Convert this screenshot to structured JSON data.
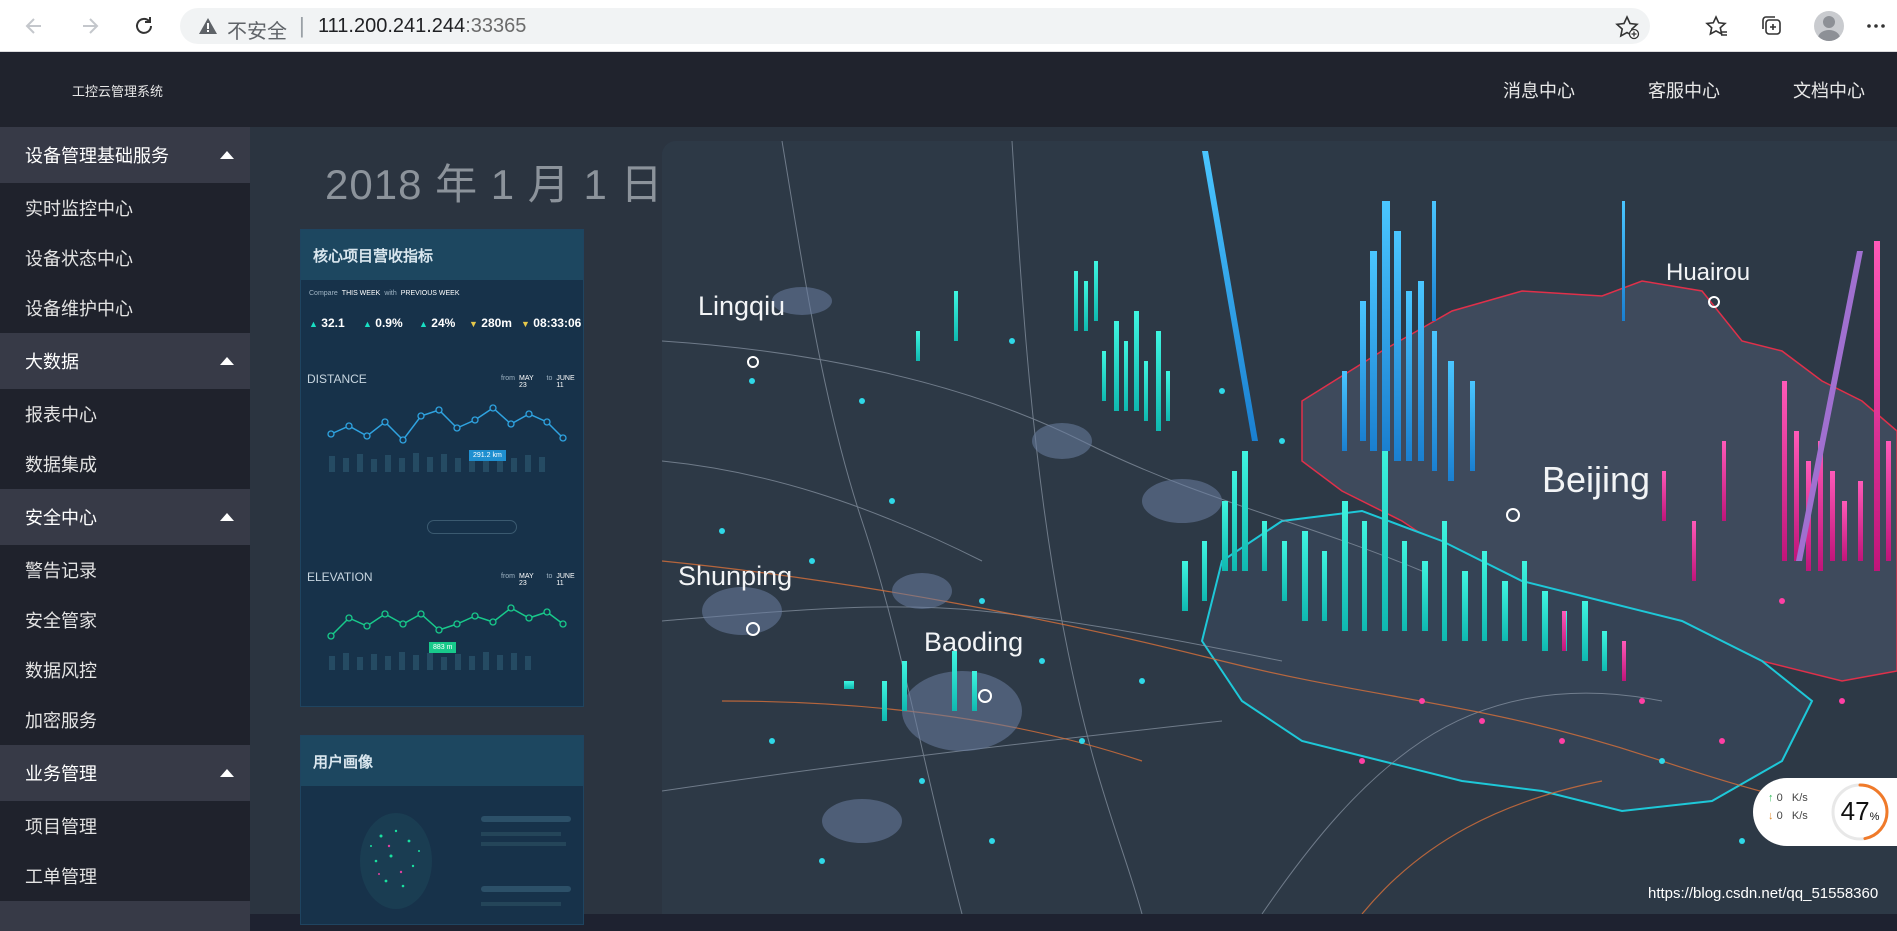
{
  "browser": {
    "insecure_label": "不安全",
    "separator": "|",
    "url_host": "111.200.241.244",
    "url_port": ":33365"
  },
  "header": {
    "app_title": "工控云管理系统",
    "nav": [
      "消息中心",
      "客服中心",
      "文档中心"
    ]
  },
  "sidebar": {
    "groups": [
      {
        "title": "设备管理基础服务",
        "items": [
          "实时监控中心",
          "设备状态中心",
          "设备维护中心"
        ]
      },
      {
        "title": "大数据",
        "items": [
          "报表中心",
          "数据集成"
        ]
      },
      {
        "title": "安全中心",
        "items": [
          "警告记录",
          "安全管家",
          "数据风控",
          "加密服务"
        ]
      },
      {
        "title": "业务管理",
        "items": [
          "项目管理",
          "工单管理"
        ]
      }
    ]
  },
  "main": {
    "date": "2018 年 1 月 1 日",
    "panel1": {
      "title": "核心项目营收指标",
      "compare": "Compare",
      "this_week": "THIS WEEK",
      "with": "with",
      "previous_week": "PREVIOUS WEEK",
      "stats": [
        {
          "value": "32.1",
          "trend": "up"
        },
        {
          "value": "0.9%",
          "trend": "up"
        },
        {
          "value": "24%",
          "trend": "up"
        },
        {
          "value": "280m",
          "trend": "down"
        },
        {
          "value": "08:33:06",
          "trend": "down"
        }
      ],
      "distance_label": "DISTANCE",
      "distance_from": "MAY 23",
      "distance_to": "JUNE 11",
      "distance_tooltip": "291.2 km",
      "elevation_label": "ELEVATION",
      "elevation_from": "MAY 23",
      "elevation_to": "JUNE 11",
      "elevation_tooltip": "883 m",
      "from": "from",
      "to": "to"
    },
    "panel2": {
      "title": "用户画像"
    }
  },
  "map": {
    "cities": [
      "Lingqiu",
      "Shunping",
      "Baoding",
      "Huairou",
      "Beijing"
    ]
  },
  "speed_widget": {
    "upload": "0",
    "download": "0",
    "unit": "K/s",
    "percent": "47",
    "percent_sign": "%",
    "percent_value": 47
  },
  "watermark": "https://blog.csdn.net/qq_51558360"
}
